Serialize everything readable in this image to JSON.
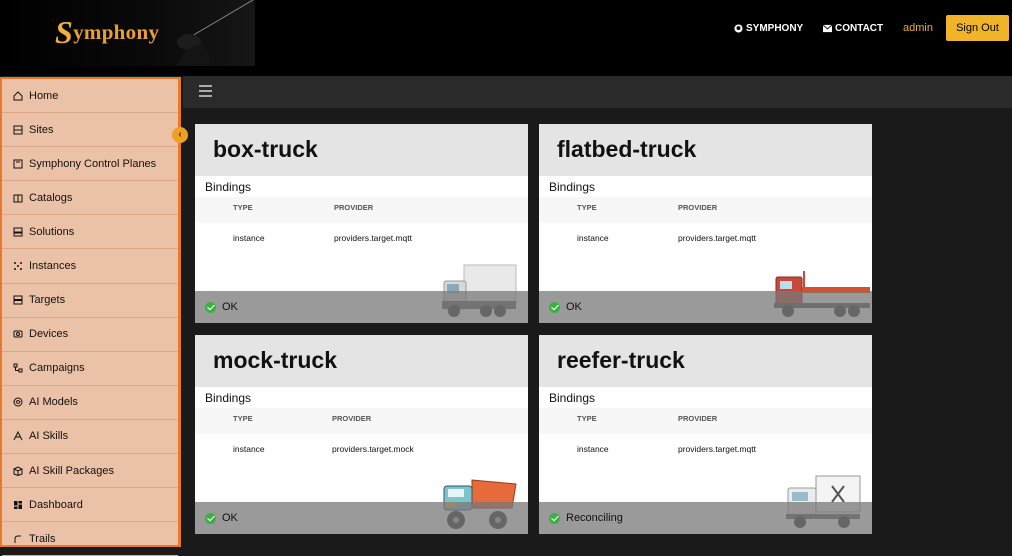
{
  "header": {
    "logo_initial": "S",
    "logo_rest": "ymphony",
    "links": [
      {
        "label": "SYMPHONY",
        "icon": "github-icon"
      },
      {
        "label": "CONTACT",
        "icon": "mail-icon"
      }
    ],
    "user": "admin",
    "signout_label": "Sign Out"
  },
  "sidebar": {
    "items": [
      {
        "label": "Home",
        "icon": "home-icon"
      },
      {
        "label": "Sites",
        "icon": "sites-icon"
      },
      {
        "label": "Symphony Control Planes",
        "icon": "control-plane-icon"
      },
      {
        "label": "Catalogs",
        "icon": "catalog-icon"
      },
      {
        "label": "Solutions",
        "icon": "solutions-icon"
      },
      {
        "label": "Instances",
        "icon": "instances-icon"
      },
      {
        "label": "Targets",
        "icon": "targets-icon"
      },
      {
        "label": "Devices",
        "icon": "devices-icon"
      },
      {
        "label": "Campaigns",
        "icon": "campaigns-icon"
      },
      {
        "label": "AI Models",
        "icon": "ai-models-icon"
      },
      {
        "label": "AI Skills",
        "icon": "ai-skills-icon"
      },
      {
        "label": "AI Skill Packages",
        "icon": "ai-skill-packages-icon"
      },
      {
        "label": "Dashboard",
        "icon": "dashboard-icon"
      },
      {
        "label": "Trails",
        "icon": "trails-icon"
      }
    ]
  },
  "cards": [
    {
      "title": "box-truck",
      "bindings_label": "Bindings",
      "col_type": "TYPE",
      "col_provider": "PROVIDER",
      "type": "instance",
      "provider": "providers.target.mqtt",
      "status": "OK"
    },
    {
      "title": "flatbed-truck",
      "bindings_label": "Bindings",
      "col_type": "TYPE",
      "col_provider": "PROVIDER",
      "type": "instance",
      "provider": "providers.target.mqtt",
      "status": "OK"
    },
    {
      "title": "mock-truck",
      "bindings_label": "Bindings",
      "col_type": "TYPE",
      "col_provider": "PROVIDER",
      "type": "instance",
      "provider": "providers.target.mock",
      "status": "OK"
    },
    {
      "title": "reefer-truck",
      "bindings_label": "Bindings",
      "col_type": "TYPE",
      "col_provider": "PROVIDER",
      "type": "instance",
      "provider": "providers.target.mqtt",
      "status": "Reconciling"
    }
  ],
  "colors": {
    "accent": "#f0b429",
    "sidebar_bg": "#ebc2a8",
    "sidebar_border": "#e8782a",
    "ok": "#3cb043"
  }
}
